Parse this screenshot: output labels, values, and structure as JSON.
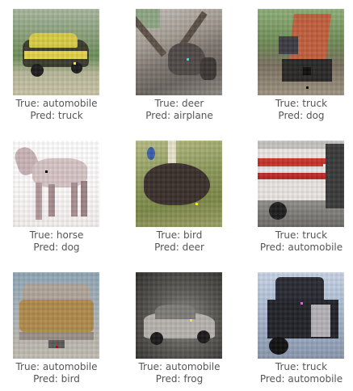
{
  "samples": [
    {
      "true_label": "True: automobile",
      "pred_label": "Pred: truck"
    },
    {
      "true_label": "True: deer",
      "pred_label": "Pred: airplane"
    },
    {
      "true_label": "True: truck",
      "pred_label": "Pred: dog"
    },
    {
      "true_label": "True: horse",
      "pred_label": "Pred: dog"
    },
    {
      "true_label": "True: bird",
      "pred_label": "Pred: deer"
    },
    {
      "true_label": "True: truck",
      "pred_label": "Pred: automobile"
    },
    {
      "true_label": "True: automobile",
      "pred_label": "Pred: bird"
    },
    {
      "true_label": "True: automobile",
      "pred_label": "Pred: frog"
    },
    {
      "true_label": "True: truck",
      "pred_label": "Pred: automobile"
    }
  ]
}
